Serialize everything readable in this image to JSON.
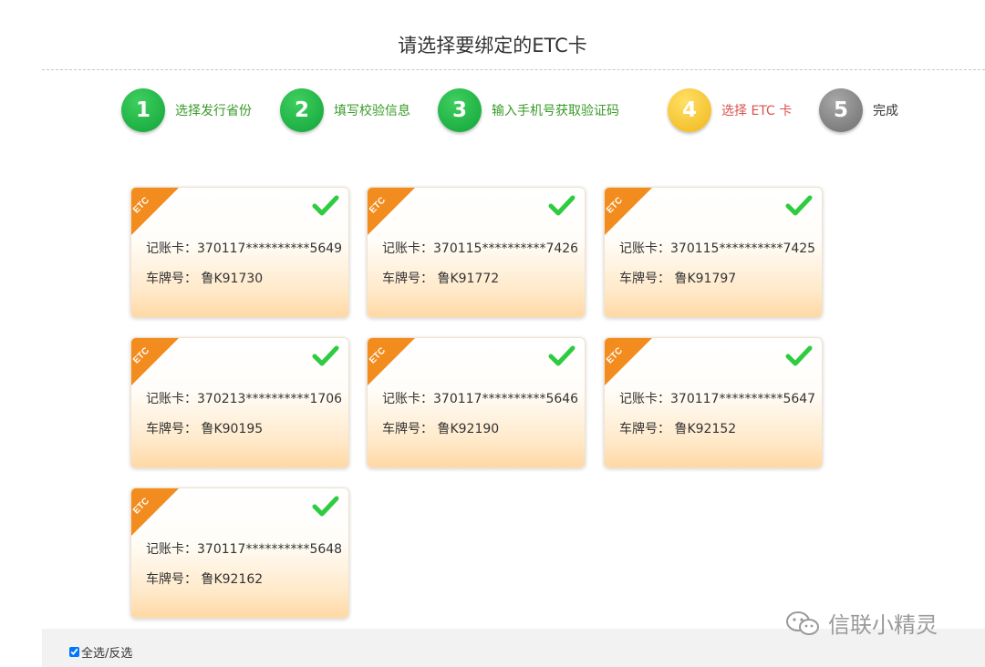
{
  "page_title": "请选择要绑定的ETC卡",
  "steps": [
    {
      "number": "1",
      "label": "选择发行省份",
      "state": "done"
    },
    {
      "number": "2",
      "label": "填写校验信息",
      "state": "done"
    },
    {
      "number": "3",
      "label": "输入手机号获取验证码",
      "state": "done"
    },
    {
      "number": "4",
      "label": "选择 ETC 卡",
      "state": "current"
    },
    {
      "number": "5",
      "label": "完成",
      "state": "pending"
    }
  ],
  "step_colors": {
    "done": "#1aae40",
    "current": "#f5c22a",
    "pending": "#8a8a8a",
    "done_label": "#3a9a2a",
    "current_label": "#d9534f"
  },
  "cards": [
    {
      "tag": "ETC",
      "account": "记账卡：370117**********5649",
      "plate": "车牌号： 鲁K91730",
      "selected": true
    },
    {
      "tag": "ETC",
      "account": "记账卡：370115**********7426",
      "plate": "车牌号： 鲁K91772",
      "selected": true
    },
    {
      "tag": "ETC",
      "account": "记账卡：370115**********7425",
      "plate": "车牌号： 鲁K91797",
      "selected": true
    },
    {
      "tag": "ETC",
      "account": "记账卡：370213**********1706",
      "plate": "车牌号： 鲁K90195",
      "selected": true
    },
    {
      "tag": "ETC",
      "account": "记账卡：370117**********5646",
      "plate": "车牌号： 鲁K92190",
      "selected": true
    },
    {
      "tag": "ETC",
      "account": "记账卡：370117**********5647",
      "plate": "车牌号： 鲁K92152",
      "selected": true
    },
    {
      "tag": "ETC",
      "account": "记账卡：370117**********5648",
      "plate": "车牌号： 鲁K92162",
      "selected": true
    }
  ],
  "card_accent": "#f28c1e",
  "check_color": "#2ecc40",
  "select_all_label": "全选/反选",
  "select_all_checked": true,
  "watermark": {
    "icon": "wechat-icon",
    "text": "信联小精灵"
  }
}
